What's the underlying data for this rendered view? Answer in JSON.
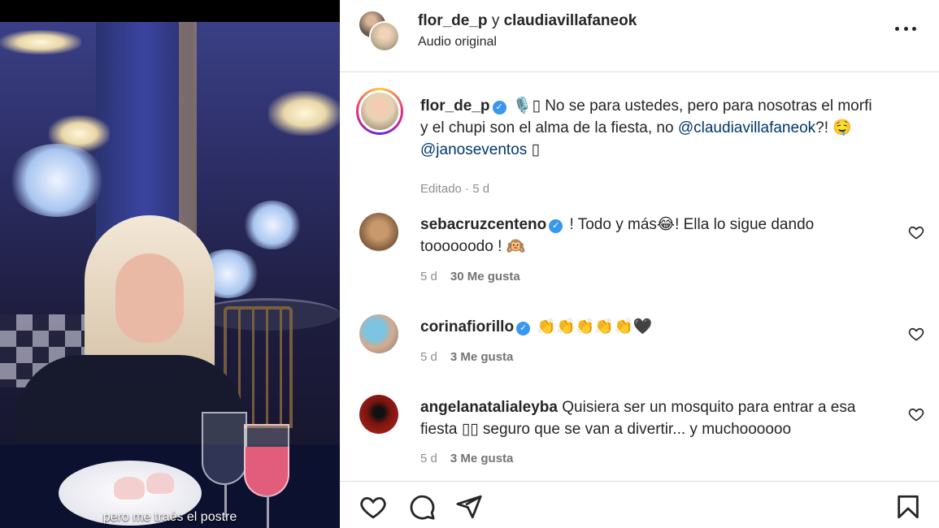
{
  "video": {
    "caption": "pero me traés el postre"
  },
  "header": {
    "user1": "flor_de_p",
    "conjunction": "y",
    "user2": "claudiavillafaneok",
    "audio_label": "Audio original"
  },
  "caption_post": {
    "username": "flor_de_p",
    "text_1": " 🎙️▯ No se para ustedes, pero para nosotras el morfi y el chupi son el alma de la fiesta, no ",
    "mention_1": "@claudiavillafaneok",
    "text_2": "?! 🤤 ",
    "mention_2": "@janoseventos",
    "text_3": " ▯",
    "meta": "Editado · 5 d"
  },
  "comments": [
    {
      "username": "sebacruzcenteno",
      "verified": true,
      "text": " ! Todo y más😂! Ella lo sigue dando toooooodo ! 🙉",
      "age": "5 d",
      "likes": "30 Me gusta"
    },
    {
      "username": "corinafiorillo",
      "verified": true,
      "text": " 👏👏👏👏👏🖤",
      "age": "5 d",
      "likes": "3 Me gusta"
    },
    {
      "username": "angelanatalialeyba",
      "verified": false,
      "text": " Quisiera ser un mosquito para entrar a esa fiesta ▯▯ seguro que se van a divertir... y muchoooooo",
      "age": "5 d",
      "likes": "3 Me gusta"
    }
  ],
  "icons": {
    "more": "more-options-icon",
    "like": "heart-icon",
    "comment": "comment-icon",
    "share": "send-icon",
    "save": "bookmark-icon"
  },
  "colors": {
    "verified": "#3897f0",
    "mention": "#00376b",
    "meta": "#8e8e8e"
  }
}
